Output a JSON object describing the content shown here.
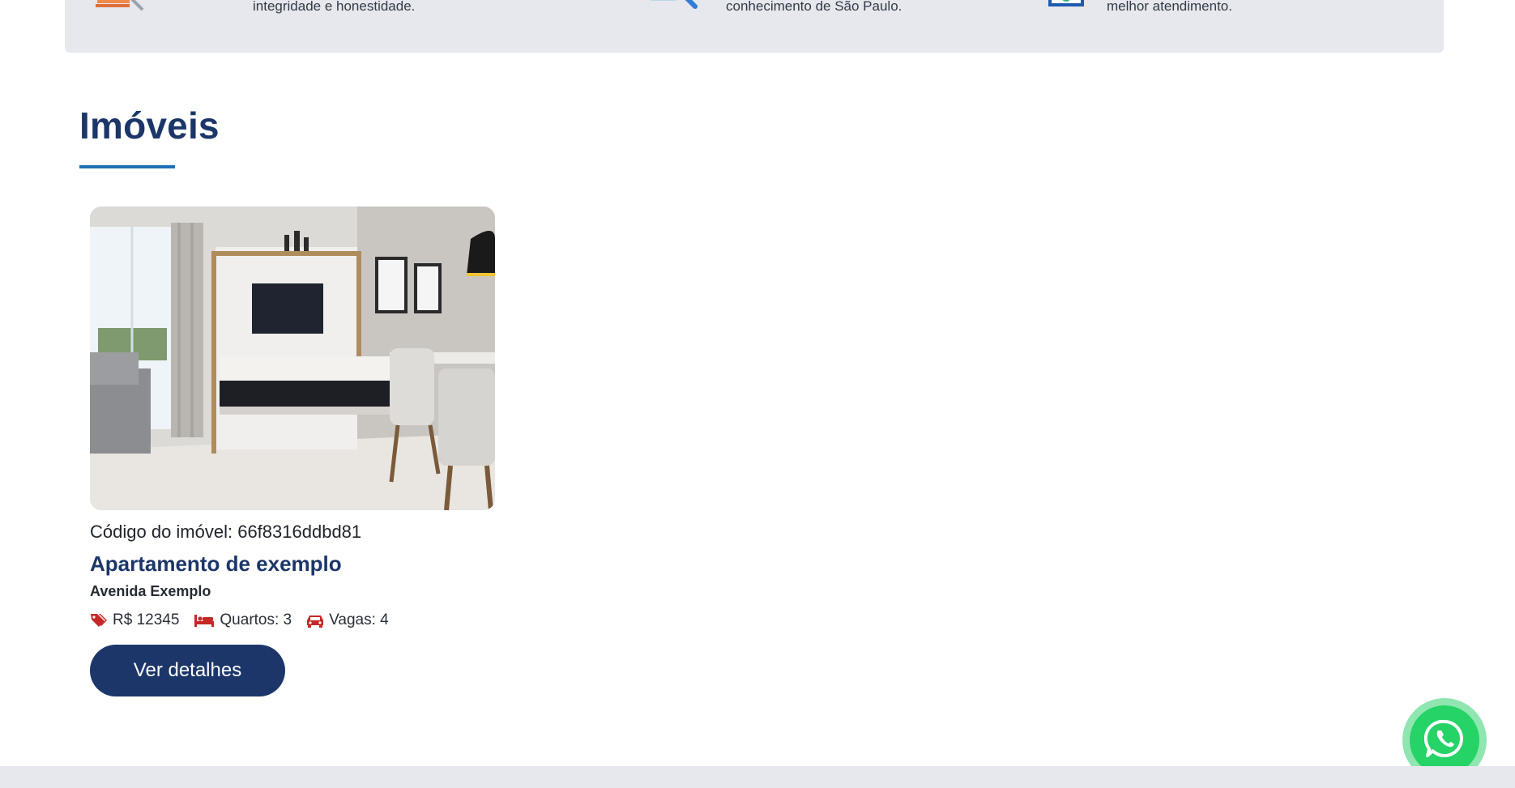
{
  "features": [
    {
      "icon": "documents-pen-icon",
      "text": "integridade e honestidade."
    },
    {
      "icon": "magnifier-document-icon",
      "text": "conhecimento de São Paulo."
    },
    {
      "icon": "certificate-check-icon",
      "text": "melhor atendimento."
    }
  ],
  "section": {
    "title": "Imóveis"
  },
  "listing": {
    "image_alt": "apartment-living-room-photo",
    "code": "Código do imóvel: 66f8316ddbd81",
    "title": "Apartamento de exemplo",
    "address": "Avenida Exemplo",
    "price": "R$ 12345",
    "rooms": "Quartos: 3",
    "parking": "Vagas: 4",
    "button_label": "Ver detalhes"
  },
  "whatsapp": {
    "icon": "whatsapp-icon"
  },
  "colors": {
    "brand_navy": "#1c3669",
    "accent_blue": "#1e6fb4",
    "icon_red": "#c62828",
    "whatsapp_green": "#25d366",
    "panel_gray": "#e6e8ee"
  }
}
